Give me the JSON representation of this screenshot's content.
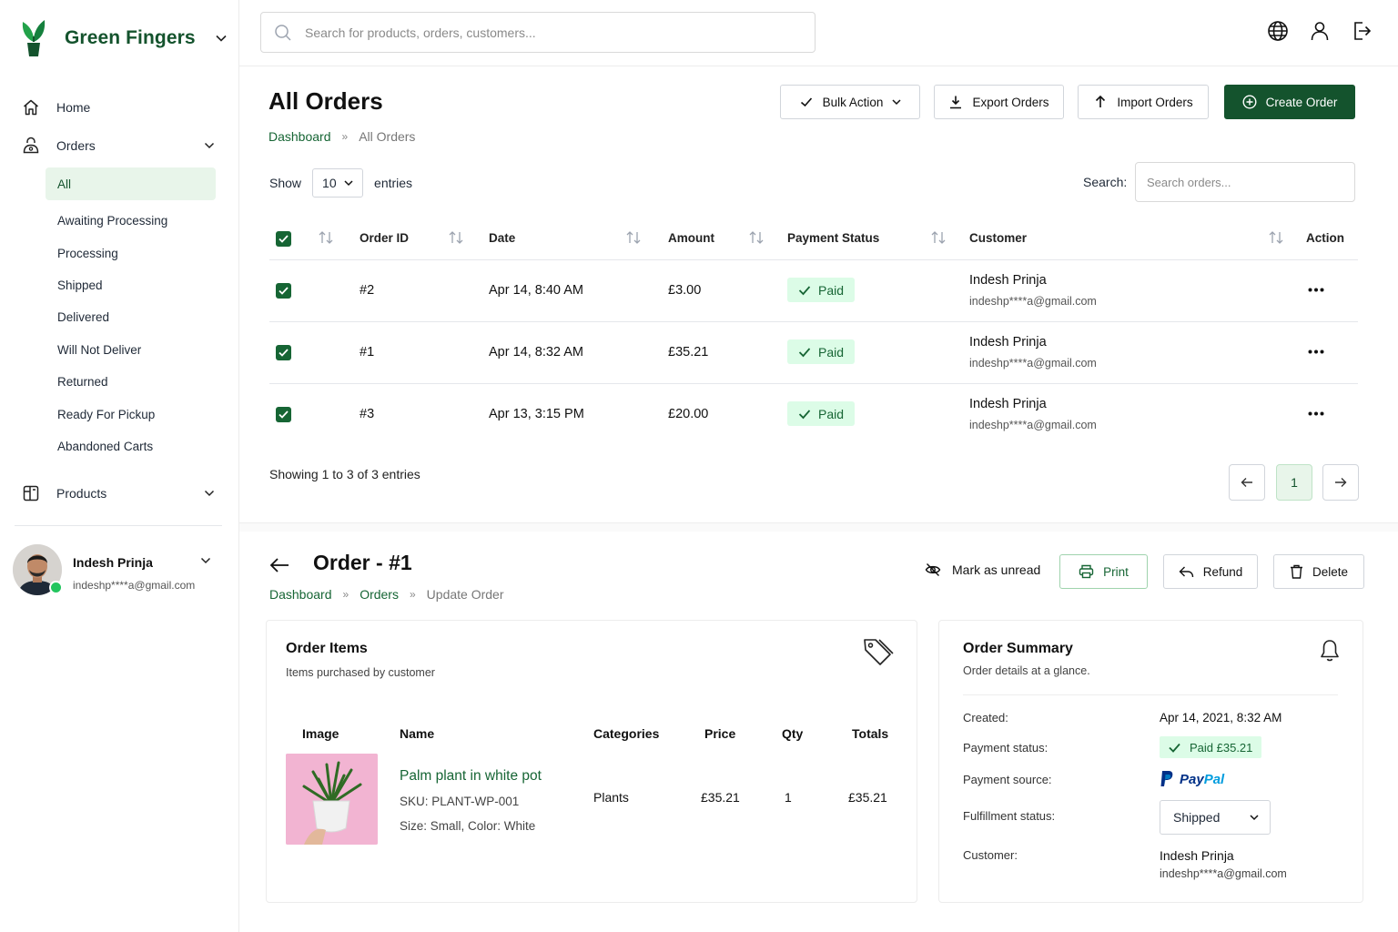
{
  "brand": {
    "name": "Green Fingers"
  },
  "colors": {
    "accent": "#14532d",
    "accent_light": "#e8f5ea",
    "paid_bg": "#dcfce7",
    "paid_text": "#166534"
  },
  "sidebar": {
    "home": "Home",
    "orders": "Orders",
    "order_subitems": [
      "All",
      "Awaiting Processing",
      "Processing",
      "Shipped",
      "Delivered",
      "Will Not Deliver",
      "Returned",
      "Ready For Pickup",
      "Abandoned Carts"
    ],
    "active_subitem": "All",
    "products": "Products"
  },
  "user": {
    "name": "Indesh Prinja",
    "email": "indeshp****a@gmail.com",
    "status": "online"
  },
  "topbar": {
    "search_placeholder": "Search for products, orders, customers...",
    "icons": [
      "globe-icon",
      "user-icon",
      "logout-icon"
    ]
  },
  "orders_page": {
    "title": "All Orders",
    "breadcrumb": [
      "Dashboard",
      "All Orders"
    ],
    "breadcrumb_sep": "»",
    "buttons": {
      "bulk": "Bulk Action",
      "export": "Export Orders",
      "import": "Import Orders",
      "create": "Create Order"
    },
    "show_label": "Show",
    "entries_value": "10",
    "entries_label": "entries",
    "search_label": "Search:",
    "search_placeholder": "Search orders...",
    "columns": [
      "Order ID",
      "Date",
      "Amount",
      "Payment Status",
      "Customer",
      "Action"
    ],
    "rows": [
      {
        "id": "#2",
        "date": "Apr 14, 8:40 AM",
        "amount": "£3.00",
        "status": "Paid",
        "customer": "Indesh Prinja",
        "email": "indeshp****a@gmail.com"
      },
      {
        "id": "#1",
        "date": "Apr 14, 8:32 AM",
        "amount": "£35.21",
        "status": "Paid",
        "customer": "Indesh Prinja",
        "email": "indeshp****a@gmail.com"
      },
      {
        "id": "#3",
        "date": "Apr 13, 3:15 PM",
        "amount": "£20.00",
        "status": "Paid",
        "customer": "Indesh Prinja",
        "email": "indeshp****a@gmail.com"
      }
    ],
    "showing": "Showing 1 to 3 of 3 entries",
    "current_page": "1"
  },
  "order_detail": {
    "title": "Order - #1",
    "breadcrumb": [
      "Dashboard",
      "Orders",
      "Update Order"
    ],
    "actions": {
      "unread": "Mark as unread",
      "print": "Print",
      "refund": "Refund",
      "delete": "Delete"
    },
    "items_card": {
      "title": "Order Items",
      "subtitle": "Items purchased by customer",
      "columns": [
        "Image",
        "Name",
        "Categories",
        "Price",
        "Qty",
        "Totals"
      ],
      "item": {
        "name": "Palm plant in white pot",
        "sku": "SKU: PLANT-WP-001",
        "variant": "Size: Small, Color: White",
        "category": "Plants",
        "price": "£35.21",
        "qty": "1",
        "total": "£35.21"
      }
    },
    "summary_card": {
      "title": "Order Summary",
      "subtitle": "Order details at a glance.",
      "labels": {
        "created": "Created:",
        "payment_status": "Payment status:",
        "payment_source": "Payment source:",
        "fulfillment": "Fulfillment status:",
        "customer": "Customer:"
      },
      "created": "Apr 14, 2021, 8:32 AM",
      "payment_status": "Paid £35.21",
      "payment_source_pay": "Pay",
      "payment_source_pal": "Pal",
      "fulfillment": "Shipped",
      "customer_name": "Indesh Prinja",
      "customer_email": "indeshp****a@gmail.com"
    }
  }
}
